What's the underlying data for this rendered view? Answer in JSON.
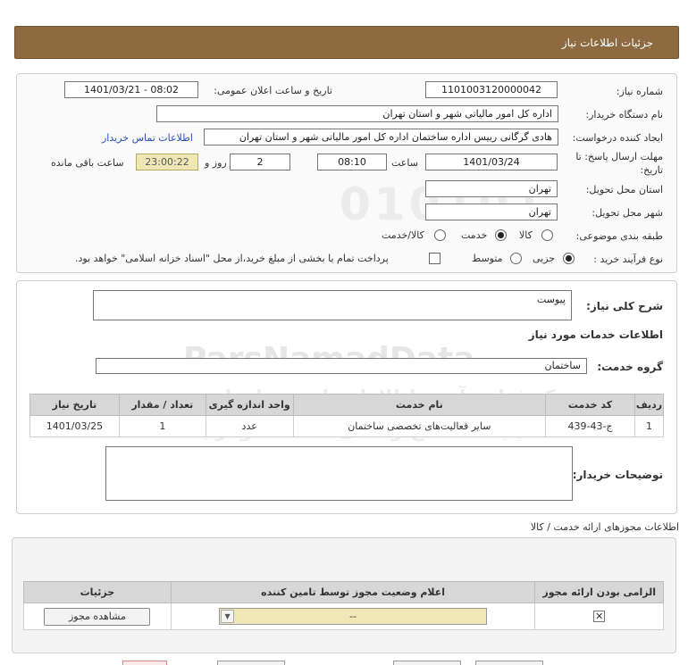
{
  "header": {
    "title": "جزئیات اطلاعات نیاز"
  },
  "form": {
    "need_number_label": "شماره نیاز:",
    "need_number": "1101003120000042",
    "announce_label": "تاریخ و ساعت اعلان عمومی:",
    "announce_value": "1401/03/21 - 08:02",
    "buyer_org_label": "نام دستگاه خریدار:",
    "buyer_org": "اداره کل امور مالیاتی شهر و استان تهران",
    "requester_label": "ایجاد کننده درخواست:",
    "requester": "هادی گرگانی رییس اداره ساختمان اداره کل امور مالیاتی شهر و استان تهران",
    "contact_link": "اطلاعات تماس خریدار",
    "deadline_label": "مهلت ارسال پاسخ: تا تاریخ:",
    "deadline_date": "1401/03/24",
    "time_label": "ساعت",
    "deadline_time": "08:10",
    "days_value": "2",
    "days_label": "روز و",
    "remaining_time": "23:00:22",
    "remaining_label": "ساعت باقی مانده",
    "province_label": "استان محل تحویل:",
    "province": "تهران",
    "city_label": "شهر محل تحویل:",
    "city": "تهران",
    "category_label": "طبقه بندی موضوعی:",
    "category_options": [
      "کالا",
      "خدمت",
      "کالا/خدمت"
    ],
    "category_selected": "خدمت",
    "process_label": "نوع فرآیند خرید :",
    "process_options": [
      "جزیی",
      "متوسط"
    ],
    "process_selected": "جزیی",
    "treasury_note": "پرداخت تمام یا بخشی از مبلغ خرید،از محل \"اسناد خزانه اسلامی\" خواهد بود."
  },
  "summary": {
    "desc_label": "شرح کلی نیاز:",
    "desc_value": "پیوست",
    "services_title": "اطلاعات خدمات مورد نیاز",
    "group_label": "گروه خدمت:",
    "group_value": "ساختمان",
    "table_headers": [
      "ردیف",
      "کد خدمت",
      "نام خدمت",
      "واحد اندازه گیری",
      "تعداد / مقدار",
      "تاریخ نیاز"
    ],
    "table_rows": [
      [
        "1",
        "ج-43-439",
        "سایر فعالیت‌های تخصصی ساختمان",
        "عدد",
        "1",
        "1401/03/25"
      ]
    ],
    "buyer_notes_label": "توضیحات خریدار:"
  },
  "permits": {
    "title": "اطلاعات مجوزهای ارائه خدمت / کالا",
    "headers": [
      "الزامی بودن ارائه مجوز",
      "اعلام وضعیت مجوز توسط تامین کننده",
      "جزئیات"
    ],
    "select_value": "--",
    "view_button": "مشاهده مجوز"
  },
  "watermark": {
    "brand": "ParsNamadData",
    "line1": "مرکز فراهم آوری اطلاعات پارس نماد داده",
    "line2": "پایگاه اطلاع رسانی مناقصه ومزایده",
    "phone": "۰۲۱-۸۸۳۴۹۶۷۰-۵"
  },
  "colors": {
    "header_bg": "#8d6a3f",
    "remaining_bg": "#efe8b6",
    "link": "#2b4ebc"
  }
}
